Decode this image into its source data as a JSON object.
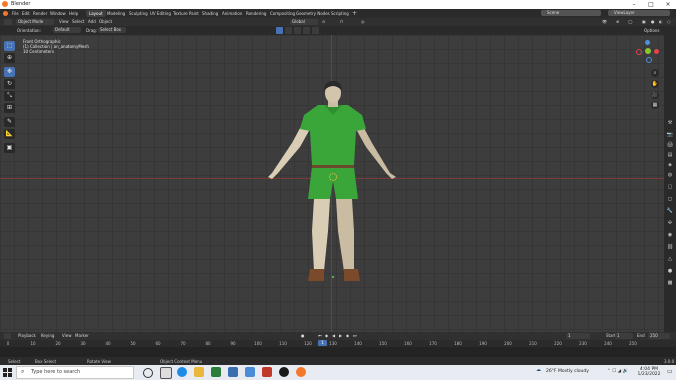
{
  "window": {
    "title": "Blender"
  },
  "menu": [
    "File",
    "Edit",
    "Render",
    "Window",
    "Help"
  ],
  "workspaces": [
    {
      "label": "Layout",
      "active": true
    },
    {
      "label": "Modeling",
      "active": false
    },
    {
      "label": "Sculpting",
      "active": false
    },
    {
      "label": "UV Editing",
      "active": false
    },
    {
      "label": "Texture Paint",
      "active": false
    },
    {
      "label": "Shading",
      "active": false
    },
    {
      "label": "Animation",
      "active": false
    },
    {
      "label": "Rendering",
      "active": false
    },
    {
      "label": "Compositing",
      "active": false
    },
    {
      "label": "Geometry Nodes",
      "active": false
    },
    {
      "label": "Scripting",
      "active": false
    }
  ],
  "scene": {
    "label": "Scene",
    "view_layer": "ViewLayer"
  },
  "header": {
    "mode": "Object Mode",
    "view": "View",
    "select": "Select",
    "add": "Add",
    "object": "Object",
    "transform_orientation": "Global"
  },
  "tool_settings": {
    "orientation_label": "Orientation:",
    "orientation_value": "Default",
    "drag_label": "Drag:",
    "drag_value": "Select Box",
    "options": "Options"
  },
  "viewport": {
    "view_name": "Front Orthographic",
    "collection": "(1) Collection | an_anatomyMesh",
    "scale": "10 Centimeters"
  },
  "gizmo": {
    "x_color": "#e5424f",
    "y_color": "#8ac531",
    "z_color": "#4f8fe0"
  },
  "timeline": {
    "playback": "Playback",
    "keying": "Keying",
    "view": "View",
    "marker": "Marker",
    "current_frame": "1",
    "start_label": "Start",
    "start_value": "1",
    "end_label": "End",
    "end_value": "250",
    "ticks": [
      "0",
      "10",
      "20",
      "30",
      "40",
      "50",
      "60",
      "70",
      "80",
      "90",
      "100",
      "110",
      "120",
      "130",
      "140",
      "150",
      "160",
      "170",
      "180",
      "190",
      "200",
      "210",
      "220",
      "230",
      "240",
      "250"
    ]
  },
  "status": {
    "select": "Select",
    "box_select": "Box Select",
    "rotate_view": "Rotate View",
    "context_menu": "Object Context Menu",
    "version": "3.0.0"
  },
  "taskbar": {
    "search_placeholder": "Type here to search",
    "weather": "26°F Mostly cloudy",
    "time": "4:04 PM",
    "date": "1/23/2022"
  },
  "colors": {
    "accent": "#4772b3",
    "shirt": "#3aa63a",
    "skin": "#d9cdb5"
  }
}
